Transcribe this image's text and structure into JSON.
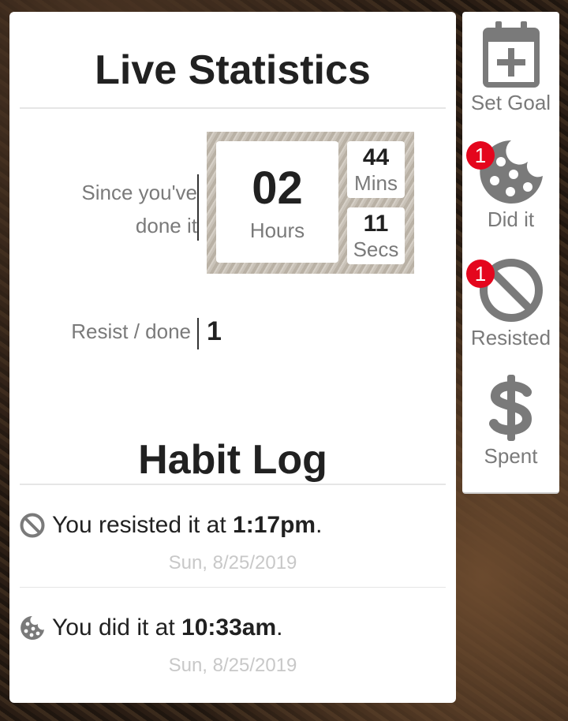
{
  "stats": {
    "title": "Live Statistics",
    "since_label_line1": "Since you've",
    "since_label_line2": "done it",
    "hours_value": "02",
    "hours_label": "Hours",
    "mins_value": "44",
    "mins_label": "Mins",
    "secs_value": "11",
    "secs_label": "Secs",
    "resist_label": "Resist / done",
    "resist_value": "1"
  },
  "log": {
    "title": "Habit Log",
    "entries": [
      {
        "icon": "ban-icon",
        "prefix": "You resisted it at ",
        "time": "1:17pm",
        "suffix": ".",
        "date": "Sun, 8/25/2019"
      },
      {
        "icon": "cookie-icon",
        "prefix": "You did it at ",
        "time": "10:33am",
        "suffix": ".",
        "date": "Sun, 8/25/2019"
      }
    ]
  },
  "sidebar": {
    "items": [
      {
        "label": "Set Goal",
        "icon": "calendar-plus-icon"
      },
      {
        "label": "Did it",
        "icon": "cookie-icon",
        "badge": "1"
      },
      {
        "label": "Resisted",
        "icon": "ban-icon",
        "badge": "1"
      },
      {
        "label": "Spent",
        "icon": "dollar-icon"
      }
    ]
  },
  "colors": {
    "accent_badge": "#e4061d",
    "icon_gray": "#7a7a7a",
    "text_dark": "#212121"
  }
}
